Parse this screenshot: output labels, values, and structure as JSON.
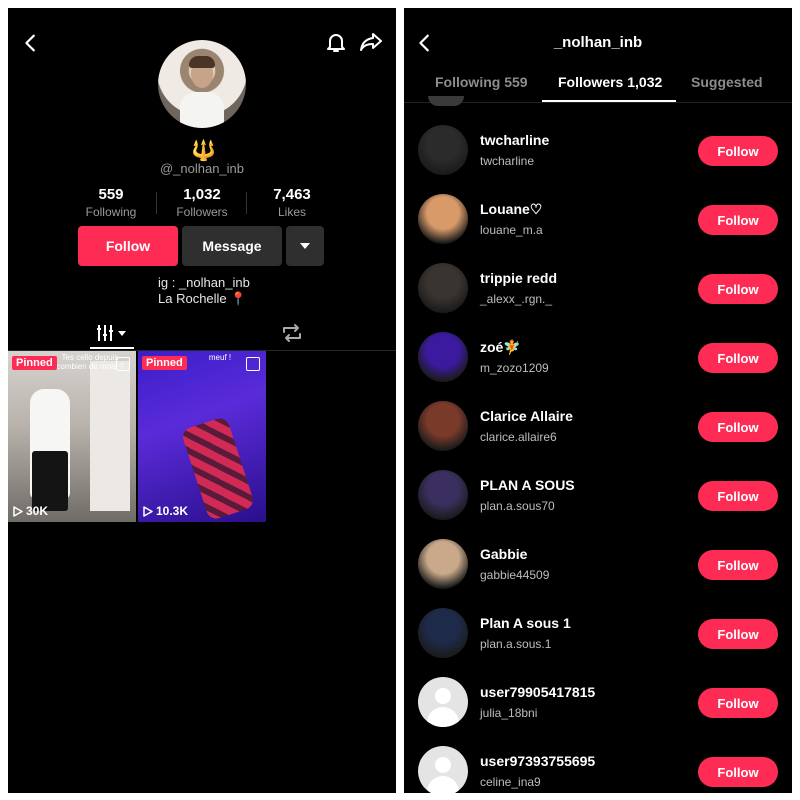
{
  "profile": {
    "emoji": "🔱",
    "username": "@_nolhan_inb",
    "stats": [
      {
        "value": "559",
        "label": "Following"
      },
      {
        "value": "1,032",
        "label": "Followers"
      },
      {
        "value": "7,463",
        "label": "Likes"
      }
    ],
    "follow_label": "Follow",
    "message_label": "Message",
    "bio_line1": "ig : _nolhan_inb",
    "bio_line2": "La Rochelle 📍",
    "videos": [
      {
        "pinned": "Pinned",
        "views": "30K",
        "caption": "Tes cello depuis combien de mois ?"
      },
      {
        "pinned": "Pinned",
        "views": "10.3K",
        "caption": "meuf !"
      }
    ]
  },
  "followers_page": {
    "title": "_nolhan_inb",
    "tabs": [
      "Following 559",
      "Followers 1,032",
      "Suggested"
    ],
    "follow_label": "Follow",
    "users": [
      {
        "name": "twcharline",
        "handle": "twcharline",
        "avatar": "#2b2b2b"
      },
      {
        "name": "Louane♡",
        "handle": "louane_m.a",
        "avatar": "#d99a6a"
      },
      {
        "name": "trippie redd",
        "handle": "_alexx_.rgn._",
        "avatar": "#3a3430"
      },
      {
        "name": "zoé🧚",
        "handle": "m_zozo1209",
        "avatar": "#3c1aa0"
      },
      {
        "name": "Clarice Allaire",
        "handle": "clarice.allaire6",
        "avatar": "#7a3a2a"
      },
      {
        "name": "PLAN A SOUS",
        "handle": "plan.a.sous70",
        "avatar": "#3a2f5e"
      },
      {
        "name": "Gabbie",
        "handle": "gabbie44509",
        "avatar": "#c9a98a"
      },
      {
        "name": "Plan A sous 1",
        "handle": "plan.a.sous.1",
        "avatar": "#1e2a4a"
      },
      {
        "name": "user79905417815",
        "handle": "julia_18bni",
        "avatar": "default"
      },
      {
        "name": "user97393755695",
        "handle": "celine_ina9",
        "avatar": "default"
      }
    ]
  }
}
